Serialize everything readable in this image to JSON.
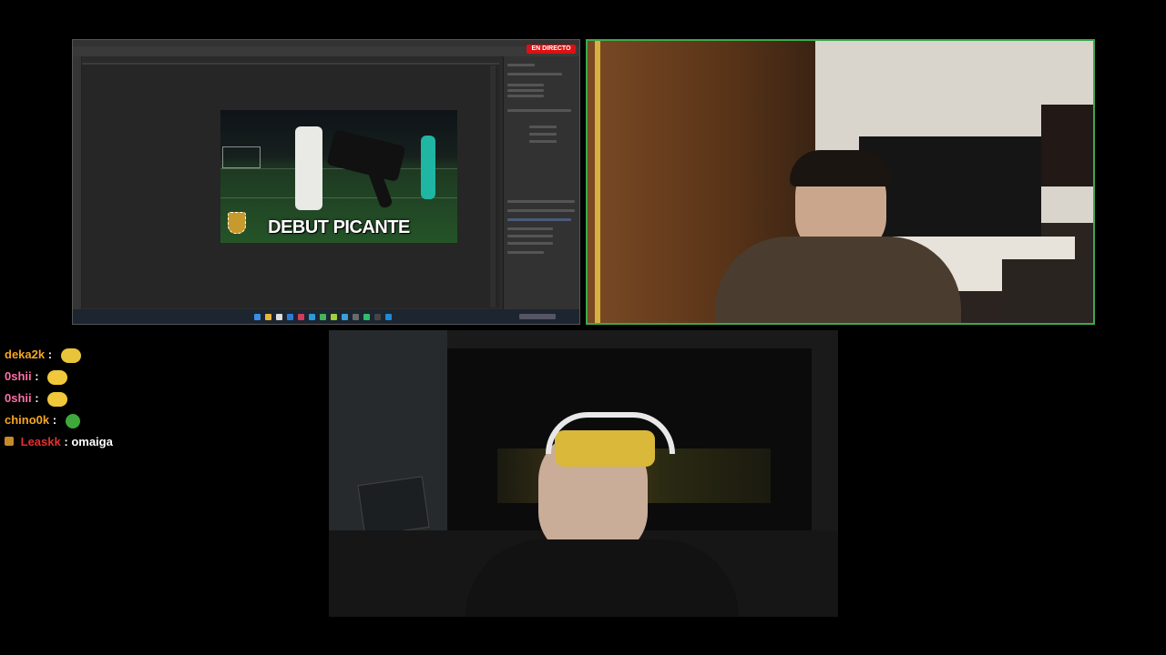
{
  "screen_share": {
    "live_badge": "EN DIRECTO",
    "meme_caption": "DEBUT PICANTE"
  },
  "chat": {
    "messages": [
      {
        "user": "deka2k",
        "separator": ":",
        "text": "",
        "emote": "emote-1",
        "color": "#f5a623"
      },
      {
        "user": "0shii",
        "separator": ":",
        "text": "",
        "emote": "emote-2",
        "color": "#ff6fa8"
      },
      {
        "user": "0shii",
        "separator": ":",
        "text": "",
        "emote": "emote-2",
        "color": "#ff6fa8"
      },
      {
        "user": "chino0k",
        "separator": ":",
        "text": "",
        "emote": "emote-3",
        "color": "#f5a623"
      },
      {
        "user": "Leaskk",
        "separator": ":",
        "text": "omaiga",
        "emote": "",
        "color": "#e0302e"
      }
    ]
  },
  "colors": {
    "webcam_border": "#3fa84a",
    "live_badge": "#d11111"
  }
}
